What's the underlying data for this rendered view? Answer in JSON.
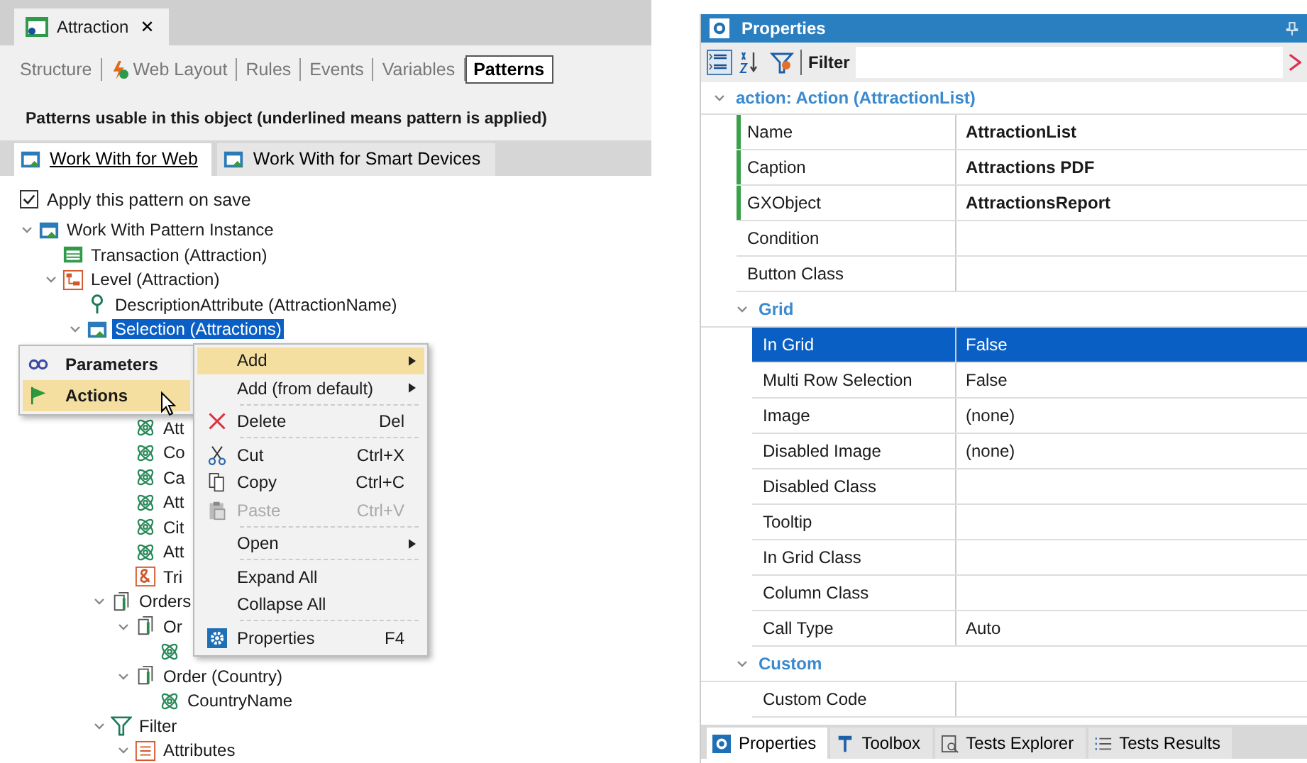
{
  "editor": {
    "document_tab": {
      "title": "Attraction",
      "close": "✕"
    },
    "subtabs": [
      {
        "label": "Structure",
        "selected": false
      },
      {
        "label": "Web Layout",
        "selected": false,
        "kind": "layout"
      },
      {
        "label": "Rules",
        "selected": false
      },
      {
        "label": "Events",
        "selected": false
      },
      {
        "label": "Variables",
        "selected": false
      },
      {
        "label": "Patterns",
        "selected": true
      }
    ],
    "hint": "Patterns usable in this object (underlined means pattern is applied)",
    "pattern_tabs": [
      {
        "label": "Work With for Web",
        "selected": true,
        "applied": true
      },
      {
        "label": "Work With for Smart Devices",
        "selected": false,
        "applied": false
      }
    ],
    "apply_on_save": {
      "label": "Apply this pattern on save",
      "checked": true
    },
    "tree": [
      {
        "label": "Work With Pattern Instance",
        "kind": "instance",
        "expanded": true,
        "children": [
          {
            "label": "Transaction (Attraction)",
            "kind": "transaction"
          },
          {
            "label": "Level (Attraction)",
            "kind": "level",
            "expanded": true,
            "children": [
              {
                "label": "DescriptionAttribute (AttractionName)",
                "kind": "key"
              },
              {
                "label": "Selection (Attractions)",
                "kind": "selection",
                "expanded": true,
                "selected": true,
                "children": [
                  {
                    "kind": "hidden",
                    "children": [
                      {
                        "label": "Att",
                        "kind": "atom"
                      },
                      {
                        "label": "Co",
                        "kind": "atom"
                      },
                      {
                        "label": "Ca",
                        "kind": "atom"
                      },
                      {
                        "label": "Att",
                        "kind": "atom"
                      },
                      {
                        "label": "Cit",
                        "kind": "atom"
                      },
                      {
                        "label": "Att",
                        "kind": "atom"
                      },
                      {
                        "label": "Tri",
                        "kind": "amp"
                      }
                    ]
                  },
                  {
                    "label": "Orders",
                    "kind": "orders",
                    "expanded": true,
                    "children": [
                      {
                        "label": "Or",
                        "kind": "order",
                        "expanded": true,
                        "children": [
                          {
                            "kind": "atom"
                          }
                        ]
                      },
                      {
                        "label": "Order (Country)",
                        "kind": "order",
                        "expanded": true,
                        "children": [
                          {
                            "label": "CountryName",
                            "kind": "atom"
                          }
                        ]
                      }
                    ]
                  },
                  {
                    "label": "Filter",
                    "kind": "filter",
                    "expanded": true,
                    "children": [
                      {
                        "label": "Attributes",
                        "kind": "attrs",
                        "expanded": true
                      }
                    ]
                  }
                ]
              }
            ]
          }
        ]
      }
    ],
    "popup_list": [
      {
        "label": "Parameters",
        "kind": "params",
        "selected": false
      },
      {
        "label": "Actions",
        "kind": "flag",
        "selected": true
      }
    ],
    "context_menu": [
      {
        "label": "Add",
        "submenu": true,
        "selected": true
      },
      {
        "label": "Add (from default)",
        "submenu": true,
        "selected": false
      },
      {
        "label": "Delete",
        "shortcut": "Del",
        "kind": "delete",
        "separator_before": true,
        "selected": false
      },
      {
        "label": "Cut",
        "shortcut": "Ctrl+X",
        "kind": "cut",
        "separator_before": true,
        "selected": false
      },
      {
        "label": "Copy",
        "shortcut": "Ctrl+C",
        "kind": "copy",
        "selected": false
      },
      {
        "label": "Paste",
        "shortcut": "Ctrl+V",
        "kind": "paste",
        "disabled": true,
        "selected": false
      },
      {
        "label": "Open",
        "submenu": true,
        "separator_before": true,
        "selected": false
      },
      {
        "label": "Expand All",
        "separator_before": true,
        "selected": false
      },
      {
        "label": "Collapse All",
        "selected": false
      },
      {
        "label": "Properties",
        "shortcut": "F4",
        "kind": "gear",
        "separator_before": true,
        "selected": false
      }
    ]
  },
  "properties": {
    "title": "Properties",
    "filter_label": "Filter",
    "group": {
      "label": "action: Action (AttractionList)",
      "expanded": true,
      "rows": [
        {
          "name": "Name",
          "value": "AttractionList",
          "modified": true,
          "selected": false
        },
        {
          "name": "Caption",
          "value": "Attractions PDF",
          "modified": true,
          "selected": false
        },
        {
          "name": "GXObject",
          "value": "AttractionsReport",
          "modified": true,
          "selected": false
        },
        {
          "name": "Condition",
          "modified": false,
          "selected": false
        },
        {
          "name": "Button Class",
          "modified": false,
          "selected": false
        }
      ],
      "groups": [
        {
          "label": "Grid",
          "expanded": true,
          "rows": [
            {
              "name": "In Grid",
              "value": "False",
              "modified": false,
              "selected": true
            },
            {
              "name": "Multi Row Selection",
              "value": "False",
              "modified": false,
              "selected": false
            },
            {
              "name": "Image",
              "value": "(none)",
              "modified": false,
              "selected": false
            },
            {
              "name": "Disabled Image",
              "value": "(none)",
              "modified": false,
              "selected": false
            },
            {
              "name": "Disabled Class",
              "modified": false,
              "selected": false
            },
            {
              "name": "Tooltip",
              "modified": false,
              "selected": false
            },
            {
              "name": "In Grid Class",
              "modified": false,
              "selected": false
            },
            {
              "name": "Column Class",
              "modified": false,
              "selected": false
            },
            {
              "name": "Call Type",
              "value": "Auto",
              "modified": false,
              "selected": false
            }
          ]
        },
        {
          "label": "Custom",
          "expanded": true,
          "rows": [
            {
              "name": "Custom Code",
              "modified": false,
              "selected": false
            }
          ]
        }
      ]
    },
    "bottom_tabs": [
      {
        "label": "Properties",
        "kind": "gear",
        "selected": true
      },
      {
        "label": "Toolbox",
        "kind": "toolbox",
        "selected": false
      },
      {
        "label": "Tests Explorer",
        "kind": "explorer",
        "selected": false
      },
      {
        "label": "Tests Results",
        "kind": "list",
        "selected": false
      }
    ]
  }
}
